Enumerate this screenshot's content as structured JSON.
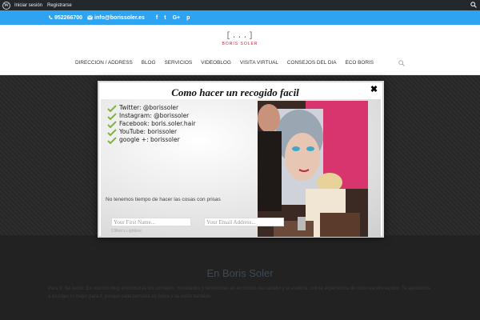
{
  "adminbar": {
    "login_label": "Iniciar sesión",
    "register_label": "Registrarse"
  },
  "topbar": {
    "phone": "952266700",
    "email": "info@borissoler.es",
    "social": [
      "f",
      "t",
      "G+",
      "p"
    ],
    "accent": "#2ea3f2"
  },
  "logo": {
    "bracket": "[...]",
    "name": "BORIS SOLER"
  },
  "nav": {
    "items": [
      "DIRECCION / ADDRESS",
      "BLOG",
      "SERVICIOS",
      "VIDEOBLOG",
      "VISITA VIRTUAL",
      "CONSEJOS DEL DIA",
      "ECO BORIS"
    ]
  },
  "lightbox": {
    "title": "Como hacer un recogido facil",
    "close": "✖",
    "social_list": [
      "Twitter: @borissoler",
      "Instagram: @borissoler",
      "Facebook: boris.soler.hair",
      "YouTube: borissoler",
      "google +: borissoler"
    ],
    "note": "No tenemos tiempo de hacer las cosas con prisas",
    "first_name_placeholder": "Your First Name...",
    "email_placeholder": "Your Email Address...",
    "brand": "Clifton's Lightbox"
  },
  "content": {
    "heading": "En Boris Soler",
    "paragraph": "Para ti, fiel lector. En nuestro blog encontrarás los consejos, novedades y tendencias en el mundo del cabello y la estética, con la experiencia de todo nuestro equipo. Te ayudamos a escoger lo mejor para ti, porque cada persona es única y su estilo también."
  }
}
